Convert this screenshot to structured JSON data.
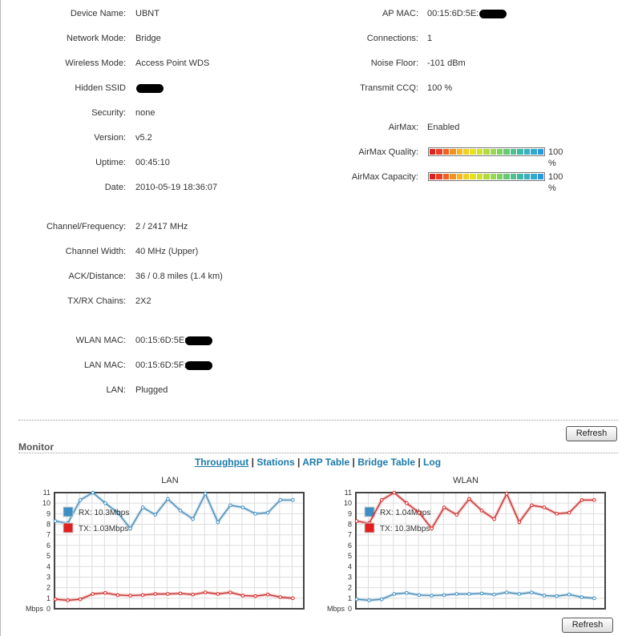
{
  "left": [
    {
      "label": "Device Name:",
      "value": "UBNT"
    },
    {
      "label": "Network Mode:",
      "value": "Bridge"
    },
    {
      "label": "Wireless Mode:",
      "value": "Access Point WDS"
    },
    {
      "label": "Hidden SSID",
      "value": "",
      "redacted": true
    },
    {
      "label": "Security:",
      "value": "none"
    },
    {
      "label": "Version:",
      "value": "v5.2"
    },
    {
      "label": "Uptime:",
      "value": "00:45:10"
    },
    {
      "label": "Date:",
      "value": "2010-05-19 18:36:07"
    },
    {
      "label": "Channel/Frequency:",
      "value": "2 / 2417 MHz"
    },
    {
      "label": "Channel Width:",
      "value": "40 MHz (Upper)"
    },
    {
      "label": "ACK/Distance:",
      "value": "36 / 0.8 miles (1.4 km)"
    },
    {
      "label": "TX/RX Chains:",
      "value": "2X2"
    },
    {
      "label": "WLAN MAC:",
      "value": "00:15:6D:5E:",
      "redacted": true
    },
    {
      "label": "LAN MAC:",
      "value": "00:15:6D:5F:",
      "redacted": true
    },
    {
      "label": "LAN:",
      "value": "Plugged"
    }
  ],
  "right": [
    {
      "label": "AP MAC:",
      "value": "00:15:6D:5E:",
      "redacted": true
    },
    {
      "label": "Connections:",
      "value": "1"
    },
    {
      "label": "Noise Floor:",
      "value": "-101 dBm"
    },
    {
      "label": "Transmit CCQ:",
      "value": "100 %"
    },
    {
      "label": "AirMax:",
      "value": "Enabled"
    }
  ],
  "airmax": [
    {
      "label": "AirMax Quality:",
      "value": "100 %",
      "percent": 100
    },
    {
      "label": "AirMax Capacity:",
      "value": "100 %",
      "percent": 100
    }
  ],
  "refresh_label": "Refresh",
  "monitor": {
    "title": "Monitor",
    "tabs": [
      "Throughput",
      "Stations",
      "ARP Table",
      "Bridge Table",
      "Log"
    ],
    "active": "Throughput",
    "sep": "|"
  },
  "chart_data": [
    {
      "type": "line",
      "title": "LAN",
      "ylabel": "Mbps",
      "ylim": [
        0,
        11
      ],
      "yticks": [
        "0",
        "1",
        "2",
        "3",
        "4",
        "5",
        "6",
        "7",
        "8",
        "9",
        "10",
        "11"
      ],
      "series": [
        {
          "name": "RX: 10.3Mbps",
          "color": "#3b8fc4",
          "values": [
            8.3,
            8.1,
            10.3,
            11,
            10,
            9.1,
            7.6,
            9.6,
            8.9,
            10.4,
            9.3,
            8.5,
            10.9,
            8.2,
            9.8,
            9.6,
            9.0,
            9.1,
            10.3,
            10.3
          ]
        },
        {
          "name": "TX: 1.03Mbps",
          "color": "#e02020",
          "values": [
            0.9,
            0.8,
            0.9,
            1.4,
            1.5,
            1.3,
            1.25,
            1.3,
            1.4,
            1.4,
            1.45,
            1.35,
            1.55,
            1.4,
            1.55,
            1.25,
            1.2,
            1.35,
            1.1,
            1.0
          ]
        }
      ]
    },
    {
      "type": "line",
      "title": "WLAN",
      "ylabel": "Mbps",
      "ylim": [
        0,
        11
      ],
      "yticks": [
        "0",
        "1",
        "2",
        "3",
        "4",
        "5",
        "6",
        "7",
        "8",
        "9",
        "10",
        "11"
      ],
      "series": [
        {
          "name": "RX: 1.04Mbps",
          "color": "#3b8fc4",
          "values": [
            0.9,
            0.8,
            0.9,
            1.4,
            1.5,
            1.3,
            1.25,
            1.3,
            1.4,
            1.4,
            1.45,
            1.35,
            1.55,
            1.4,
            1.55,
            1.25,
            1.2,
            1.35,
            1.1,
            1.0
          ]
        },
        {
          "name": "TX: 10.3Mbps",
          "color": "#e02020",
          "values": [
            8.3,
            8.1,
            10.3,
            11,
            10,
            9.1,
            7.6,
            9.6,
            8.9,
            10.4,
            9.3,
            8.5,
            10.9,
            8.2,
            9.8,
            9.6,
            9.0,
            9.1,
            10.3,
            10.3
          ]
        }
      ]
    }
  ]
}
